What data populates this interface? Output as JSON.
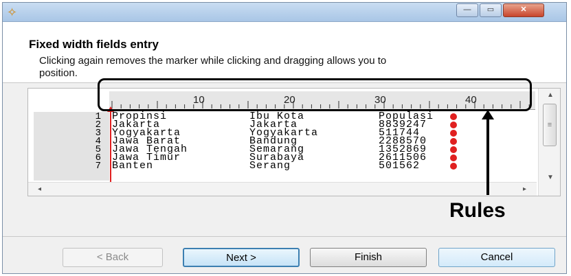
{
  "window": {
    "app_icon": "wand-icon",
    "minimize_label": "—",
    "maximize_label": "▭",
    "close_label": "✕"
  },
  "header": {
    "title": "Fixed width fields entry",
    "description": "Clicking again removes the marker while clicking and dragging allows you to position."
  },
  "ruler": {
    "labels": [
      "10",
      "20",
      "30",
      "40"
    ]
  },
  "rows": [
    {
      "num": "1",
      "col1": "Propinsi",
      "col2": "Ibu Kota",
      "col3": "Populasi"
    },
    {
      "num": "2",
      "col1": "Jakarta",
      "col2": "Jakarta",
      "col3": "8839247"
    },
    {
      "num": "3",
      "col1": "Yogyakarta",
      "col2": "Yogyakarta",
      "col3": "511744"
    },
    {
      "num": "4",
      "col1": "Jawa Barat",
      "col2": "Bandung",
      "col3": "2288570"
    },
    {
      "num": "5",
      "col1": "Jawa Tengah",
      "col2": "Semarang",
      "col3": "1352869"
    },
    {
      "num": "6",
      "col1": "Jawa Timur",
      "col2": "Surabaya",
      "col3": "2611506"
    },
    {
      "num": "7",
      "col1": "Banten",
      "col2": "Serang",
      "col3": "501562"
    }
  ],
  "annotation": {
    "label": "Rules"
  },
  "buttons": {
    "back": "< Back",
    "next": "Next >",
    "finish": "Finish",
    "cancel": "Cancel"
  },
  "colors": {
    "marker": "#e02020",
    "callout": "#000000"
  }
}
